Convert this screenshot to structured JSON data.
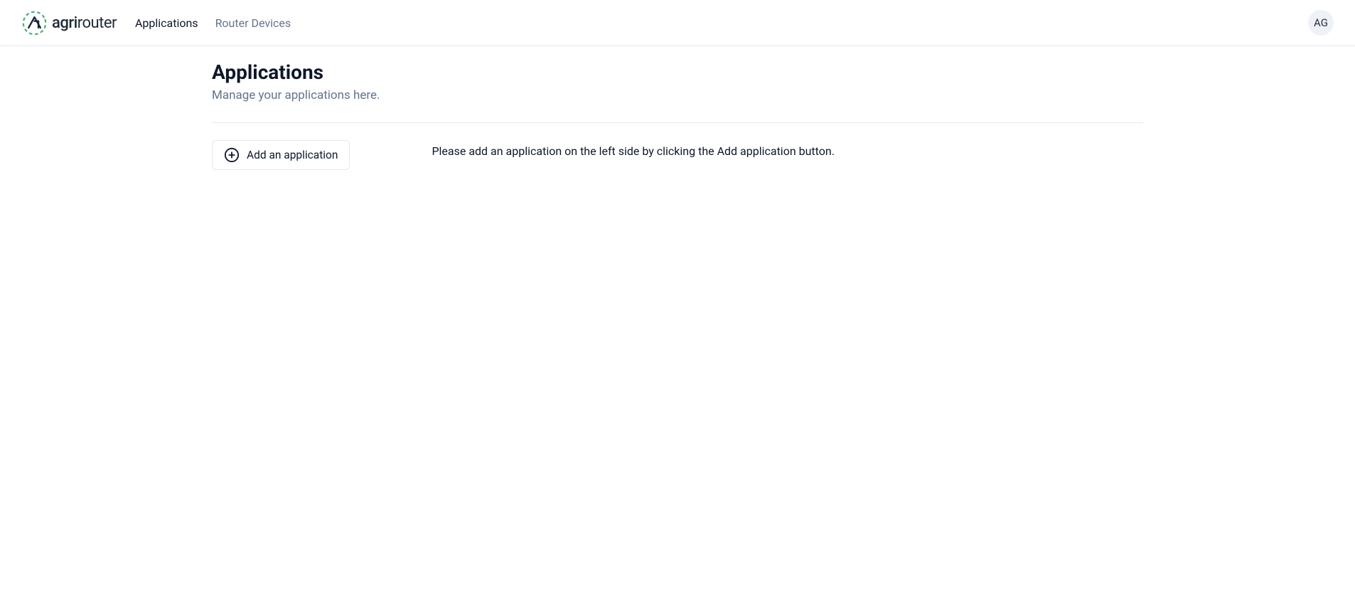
{
  "brand": {
    "name_part1": "agri",
    "name_part2": "router"
  },
  "nav": {
    "items": [
      {
        "label": "Applications",
        "active": true
      },
      {
        "label": "Router Devices",
        "active": false
      }
    ]
  },
  "user": {
    "initials": "AG"
  },
  "page": {
    "title": "Applications",
    "subtitle": "Manage your applications here."
  },
  "actions": {
    "add_application_label": "Add an application"
  },
  "main": {
    "empty_message": "Please add an application on the left side by clicking the Add application button."
  }
}
